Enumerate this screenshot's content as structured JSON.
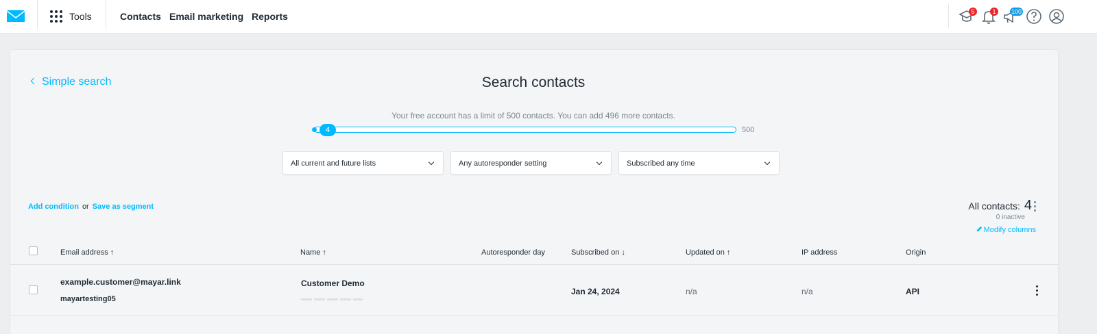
{
  "nav": {
    "tools_label": "Tools",
    "items": [
      "Contacts",
      "Email marketing",
      "Reports"
    ],
    "badges": {
      "academy": "5",
      "notifications": "1",
      "announcements": "100"
    }
  },
  "search": {
    "back_label": "Simple search",
    "title": "Search contacts",
    "limit_text": "Your free account has a limit of 500 contacts. You can add 496 more contacts.",
    "slider_value": "4",
    "slider_max": "500",
    "slider_fraction": 0.008
  },
  "filters": [
    "All current and future lists",
    "Any autoresponder setting",
    "Subscribed any time"
  ],
  "conditions": {
    "add": "Add condition",
    "or": "or",
    "save": "Save as segment"
  },
  "summary": {
    "all_label": "All contacts:",
    "count": "4",
    "inactive": "0 inactive",
    "modify_columns": "Modify columns"
  },
  "table": {
    "columns": [
      "Email address ↑",
      "Name ↑",
      "Autoresponder day",
      "Subscribed on ↓",
      "Updated on ↑",
      "IP address",
      "Origin"
    ],
    "rows": [
      {
        "email": "example.customer@mayar.link",
        "list": "mayartesting05",
        "name": "Customer Demo",
        "autoresponder_day": "",
        "subscribed_on": "Jan 24, 2024",
        "updated_on": "n/a",
        "ip": "n/a",
        "origin": "API"
      }
    ]
  },
  "colors": {
    "accent": "#00baff",
    "badge_red": "#e8262c",
    "badge_blue": "#1a9be0"
  }
}
